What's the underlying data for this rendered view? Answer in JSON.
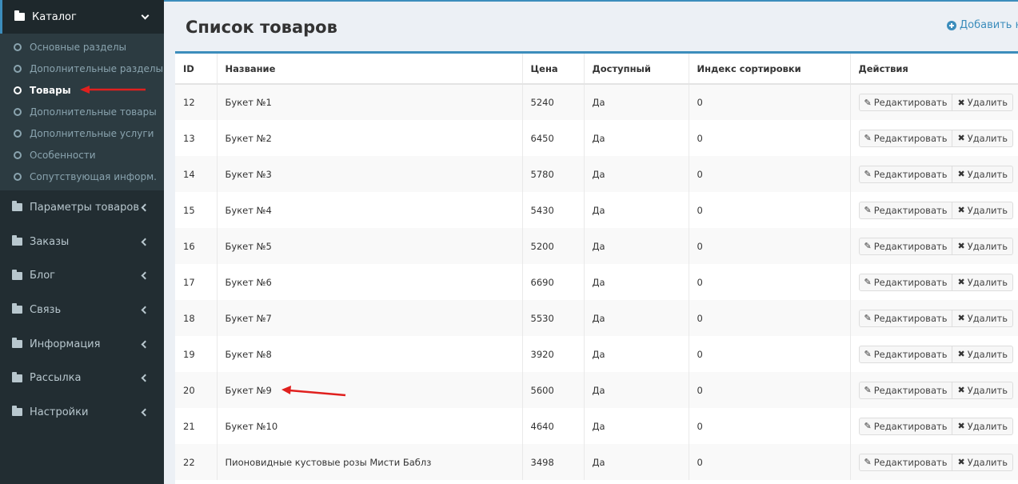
{
  "sidebar": {
    "catalog": {
      "label": "Каталог",
      "icon": "folder-icon"
    },
    "catalog_items": [
      {
        "label": "Основные разделы",
        "active": false
      },
      {
        "label": "Дополнительные разделы",
        "active": false
      },
      {
        "label": "Товары",
        "active": true
      },
      {
        "label": "Дополнительные товары",
        "active": false
      },
      {
        "label": "Дополнительные услуги",
        "active": false
      },
      {
        "label": "Особенности",
        "active": false
      },
      {
        "label": "Сопутствующая информ.",
        "active": false
      }
    ],
    "menu": [
      {
        "label": "Параметры товаров"
      },
      {
        "label": "Заказы"
      },
      {
        "label": "Блог"
      },
      {
        "label": "Связь"
      },
      {
        "label": "Информация"
      },
      {
        "label": "Рассылка"
      },
      {
        "label": "Настройки"
      }
    ]
  },
  "header": {
    "title": "Список товаров",
    "add_label": "Добавить но"
  },
  "table": {
    "columns": [
      "ID",
      "Название",
      "Цена",
      "Доступный",
      "Индекс сортировки",
      "Действия"
    ],
    "edit_label": "Редактировать",
    "delete_label": "Удалить",
    "rows": [
      {
        "id": "12",
        "name": "Букет №1",
        "price": "5240",
        "available": "Да",
        "sort": "0"
      },
      {
        "id": "13",
        "name": "Букет №2",
        "price": "6450",
        "available": "Да",
        "sort": "0"
      },
      {
        "id": "14",
        "name": "Букет №3",
        "price": "5780",
        "available": "Да",
        "sort": "0"
      },
      {
        "id": "15",
        "name": "Букет №4",
        "price": "5430",
        "available": "Да",
        "sort": "0"
      },
      {
        "id": "16",
        "name": "Букет №5",
        "price": "5200",
        "available": "Да",
        "sort": "0"
      },
      {
        "id": "17",
        "name": "Букет №6",
        "price": "6690",
        "available": "Да",
        "sort": "0"
      },
      {
        "id": "18",
        "name": "Букет №7",
        "price": "5530",
        "available": "Да",
        "sort": "0"
      },
      {
        "id": "19",
        "name": "Букет №8",
        "price": "3920",
        "available": "Да",
        "sort": "0"
      },
      {
        "id": "20",
        "name": "Букет №9",
        "price": "5600",
        "available": "Да",
        "sort": "0"
      },
      {
        "id": "21",
        "name": "Букет №10",
        "price": "4640",
        "available": "Да",
        "sort": "0"
      },
      {
        "id": "22",
        "name": "Пионовидные кустовые розы Мисти Баблз",
        "price": "3498",
        "available": "Да",
        "sort": "0"
      }
    ]
  },
  "colors": {
    "sidebar_bg": "#222d32",
    "accent": "#3c8dbc",
    "annotation_arrow": "#e0201e"
  }
}
